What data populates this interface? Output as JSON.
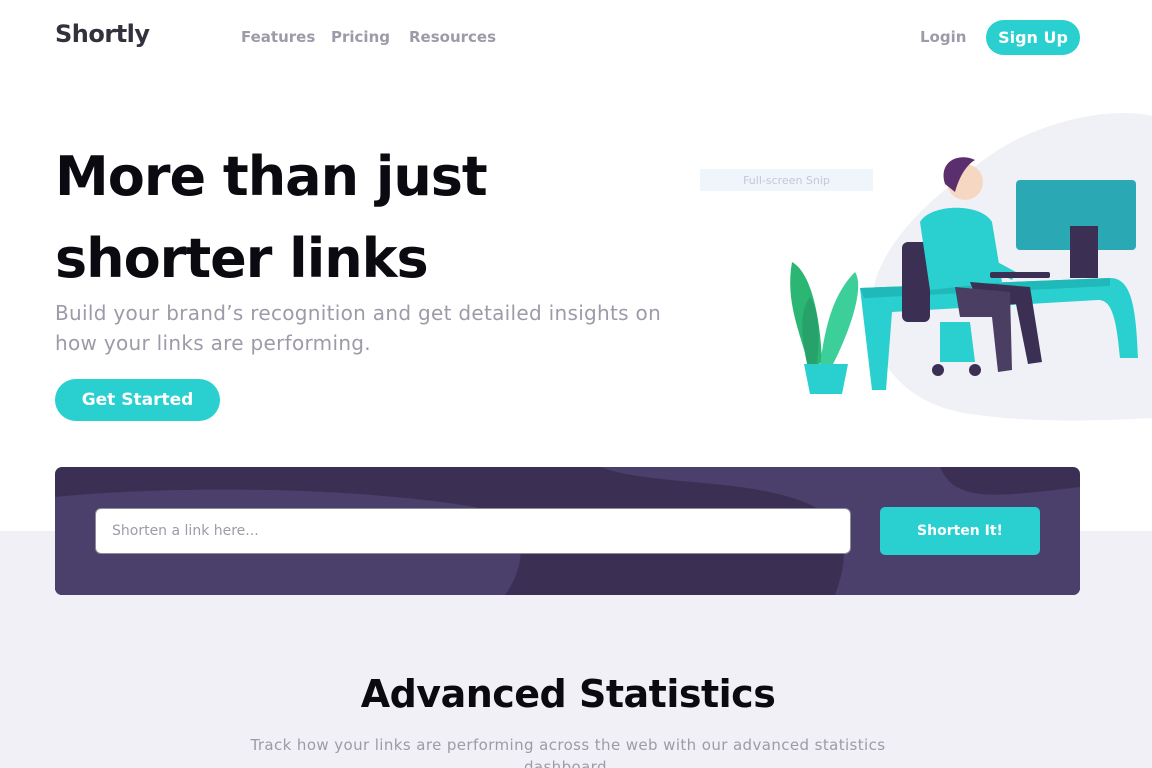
{
  "header": {
    "logo": "Shortly",
    "nav": [
      {
        "label": "Features"
      },
      {
        "label": "Pricing"
      },
      {
        "label": "Resources"
      }
    ],
    "login_label": "Login",
    "signup_label": "Sign Up"
  },
  "hero": {
    "title": "More than just shorter links",
    "subtitle": "Build your brand’s recognition and get detailed insights on how your links are performing.",
    "cta_label": "Get Started",
    "overlay_label": "Full-screen Snip",
    "illustration_icon": "person-working-illustration"
  },
  "shorten": {
    "placeholder": "Shorten a link here...",
    "button_label": "Shorten It!"
  },
  "stats": {
    "title": "Advanced Statistics",
    "subtitle": "Track how your links are performing across the web with our advanced statistics dashboard."
  },
  "colors": {
    "accent": "#2acfcf",
    "dark_violet": "#3b3054",
    "grayish_violet": "#9e9aa8",
    "light_bg": "#f0f0f6"
  }
}
